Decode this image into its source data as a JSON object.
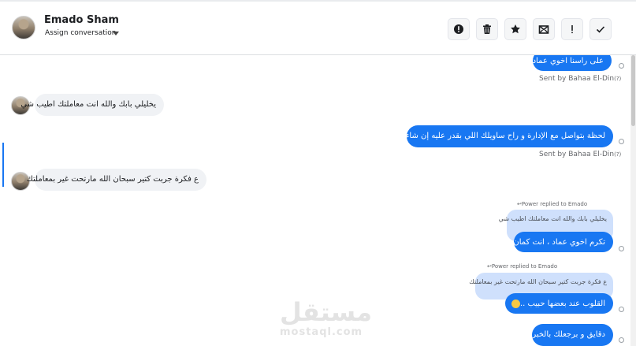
{
  "header": {
    "contact_name": "Emado Sham",
    "assign_label": "Assign conversation",
    "toolbar": [
      {
        "name": "report-spam-icon"
      },
      {
        "name": "trash-icon"
      },
      {
        "name": "star-icon"
      },
      {
        "name": "mark-unread-icon"
      },
      {
        "name": "important-icon"
      },
      {
        "name": "done-check-icon"
      }
    ]
  },
  "messages": {
    "m1": {
      "text": "على راسنا اخوي عماد"
    },
    "m1_sent": "Sent by Bahaa El-Din",
    "m1_sent_suffix": "(?)",
    "m2": {
      "text": "يخليلي بابك والله انت معاملتك اطيب شي"
    },
    "m3": {
      "text": "لحظة بتواصل مع الإدارة و راح ساويلك اللي بقدر عليه إن شاء الله"
    },
    "m3_sent": "Sent by Bahaa El-Din",
    "m3_sent_suffix": "(?)",
    "m4": {
      "text": "ع فكرة جربت كتير سبحان الله مارتحت غير بمعاملتك"
    },
    "r1": {
      "replied_label": "Power replied to Emado",
      "quote": "يخليلي بابك والله انت معاملتك اطيب شي",
      "reply": "تكرم اخوي عماد ، انت كمان"
    },
    "r2": {
      "replied_label": "Power replied to Emado",
      "quote": "ع فكرة جربت كتير سبحان الله مارتحت غير بمعاملتك",
      "reply": "القلوب عند بعضها حبيب .."
    },
    "m_last": {
      "text": "دقايق و برجعلك بالخبر"
    }
  },
  "watermark": {
    "arabic": "مستقل",
    "latin": "mostaql.com"
  },
  "colors": {
    "accent": "#1877f2",
    "incoming": "#f0f2f5",
    "quote": "#cfe0fc"
  }
}
